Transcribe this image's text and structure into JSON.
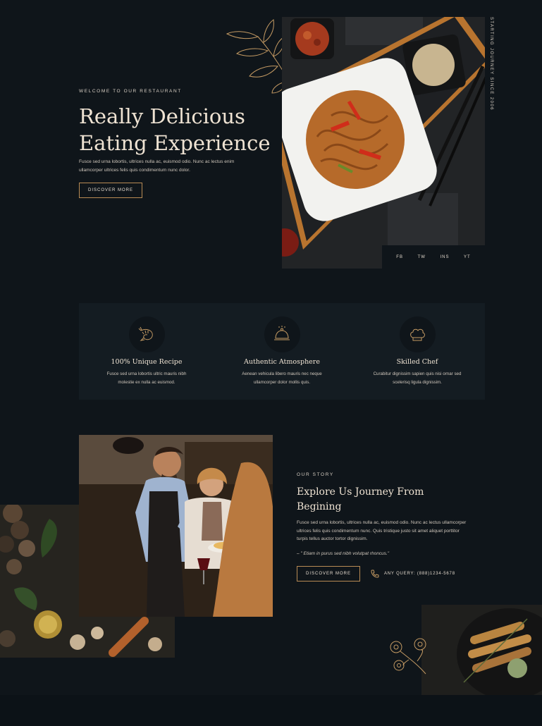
{
  "hero": {
    "eyebrow": "WELCOME TO OUR RESTAURANT",
    "title_line1": "Really Delicious",
    "title_line2": "Eating Experience",
    "body_line1": "Fusce sed urna lobortis, ultrices nulla ac, euismod odio. Nunc ac lectus enim",
    "body_line2": "ullamcorper ultrices felis quis condimentum nunc dolor.",
    "button_label": "DISCOVER MORE",
    "vertical_text": "STARTING JOURNEY SINCE 2006"
  },
  "social": [
    "FB",
    "TW",
    "INS",
    "YT"
  ],
  "features": [
    {
      "icon": "shrimp-icon",
      "title": "100% Unique Recipe",
      "line1": "Fusce sed urna lobortis ultric mauris nibh",
      "line2": "molestie ex nulla ac euismod."
    },
    {
      "icon": "cloche-icon",
      "title": "Authentic Atmosphere",
      "line1": "Aenean vehicula libero mauris nec neque",
      "line2": "ullamcorper dolor mollis quis."
    },
    {
      "icon": "chef-hat-icon",
      "title": "Skilled Chef",
      "line1": "Curabitur dignissim sapien quis nisi ornar sed",
      "line2": "scelerisq ligula dignissim."
    }
  ],
  "story": {
    "eyebrow": "OUR STORY",
    "title_line1": "Explore Us Journey From",
    "title_line2": "Begining",
    "body_line1": "Fusce sed urna lobortis, ultrices nulla ac, euismod odio. Nunc ac lectus ullamcorper",
    "body_line2": "ultrices felis quis condimentum nunc. Quis tristique justo sit amet aliquet porttitor",
    "body_line3": "turpis tellus auctor tortor dignissim.",
    "quote": "– \" Etiam in purus sed nibh volutpat rhoncus.\"",
    "button_label": "DISCOVER MORE",
    "phone_text": "ANY QUERY: (888)1234-5678"
  },
  "colors": {
    "background": "#0f151a",
    "accent": "#c49a63",
    "panel": "#141c22"
  }
}
